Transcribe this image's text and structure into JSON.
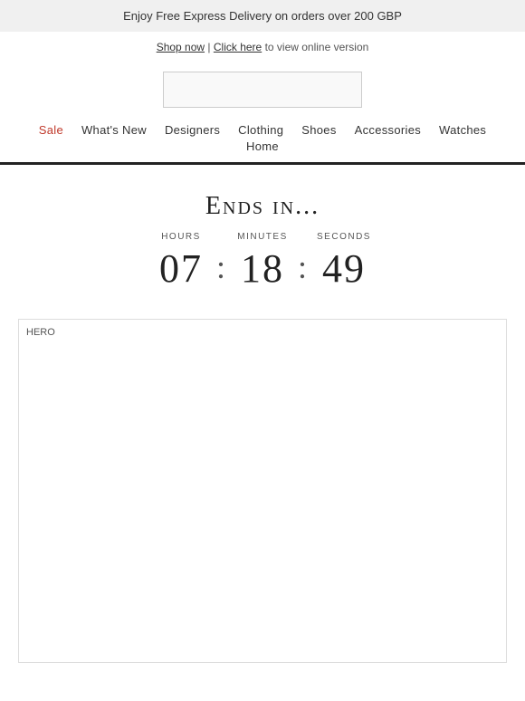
{
  "banner": {
    "text": "Enjoy Free Express Delivery on orders over 200 GBP"
  },
  "subheader": {
    "shop_now_label": "Shop now",
    "click_here_label": "Click here",
    "view_text": " to view online version"
  },
  "nav": {
    "items": [
      {
        "label": "Sale",
        "class": "sale"
      },
      {
        "label": "What's New",
        "class": ""
      },
      {
        "label": "Designers",
        "class": ""
      },
      {
        "label": "Clothing",
        "class": ""
      },
      {
        "label": "Shoes",
        "class": ""
      },
      {
        "label": "Accessories",
        "class": ""
      },
      {
        "label": "Watches",
        "class": ""
      },
      {
        "label": "Home",
        "class": ""
      }
    ]
  },
  "countdown": {
    "title": "Ends in...",
    "labels": {
      "hours": "Hours",
      "minutes": "Minutes",
      "seconds": "Seconds"
    },
    "values": {
      "hours": "07",
      "minutes": "18",
      "seconds": "49"
    }
  },
  "hero": {
    "alt": "HERO",
    "label": "HERO"
  }
}
